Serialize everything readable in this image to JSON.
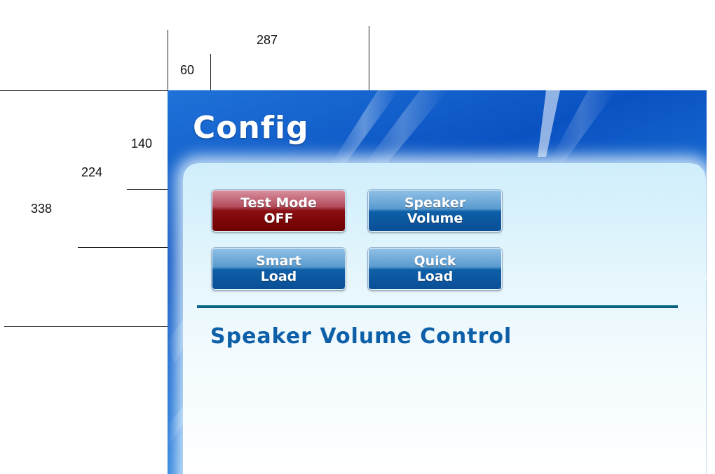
{
  "annotations": {
    "dim_287": "287",
    "dim_60": "60",
    "dim_140": "140",
    "dim_224": "224",
    "dim_338": "338"
  },
  "app": {
    "title": "Config",
    "accent_color": "#0d5fa8",
    "background_color": "#1565d4"
  },
  "buttons": {
    "test_mode": {
      "line1": "Test Mode",
      "line2": "OFF",
      "color": "#8a0f12"
    },
    "speaker_volume": {
      "line1": "Speaker",
      "line2": "Volume",
      "color": "#0e5fa8"
    },
    "smart_load": {
      "line1": "Smart",
      "line2": "Load",
      "color": "#0e5fa8"
    },
    "quick_load": {
      "line1": "Quick",
      "line2": "Load",
      "color": "#0e5fa8"
    }
  },
  "section": {
    "title": "Speaker Volume Control"
  }
}
